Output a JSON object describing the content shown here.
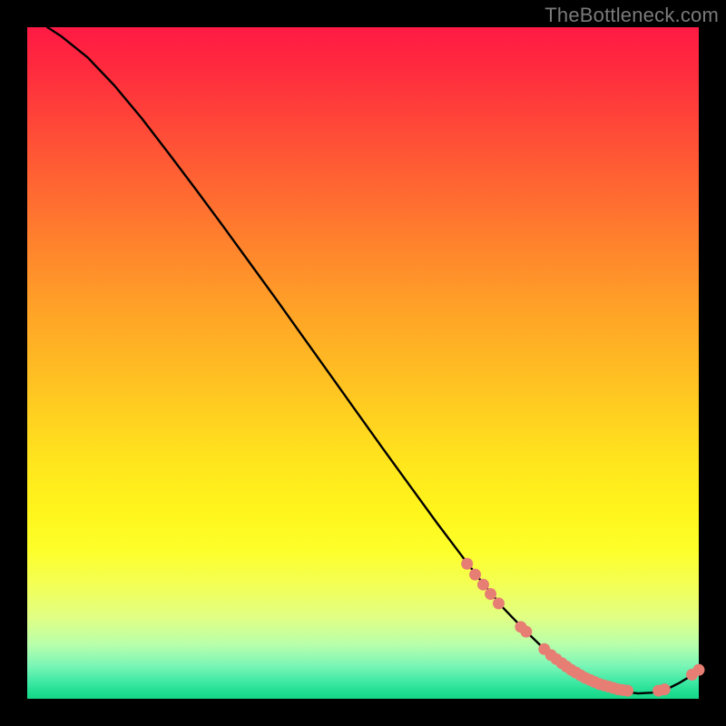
{
  "watermark": {
    "text": "TheBottleneck.com"
  },
  "colors": {
    "background": "#000000",
    "curve": "#000000",
    "point": "#e77e74",
    "gradient_top": "#ff1a44",
    "gradient_bottom": "#16d686"
  },
  "chart_data": {
    "type": "line",
    "title": "",
    "xlabel": "",
    "ylabel": "",
    "xlim": [
      0,
      100
    ],
    "ylim": [
      0,
      100
    ],
    "annotations": [],
    "series": [
      {
        "name": "curve",
        "style": "line",
        "x": [
          3,
          5,
          9,
          13,
          17,
          21,
          25,
          29,
          33,
          37,
          41,
          45,
          49,
          53,
          57,
          61,
          65,
          68,
          71,
          74,
          77,
          79,
          81,
          83,
          85,
          87,
          89,
          91,
          93,
          95,
          97,
          98.5,
          100
        ],
        "y": [
          100,
          98.7,
          95.5,
          91.3,
          86.5,
          81.3,
          76,
          70.6,
          65.1,
          59.6,
          54,
          48.4,
          42.8,
          37.2,
          31.7,
          26.2,
          20.9,
          17,
          13.4,
          10.3,
          7.4,
          5.7,
          4.2,
          3,
          2.1,
          1.4,
          1,
          0.8,
          0.9,
          1.3,
          2.3,
          3.2,
          4.3
        ]
      },
      {
        "name": "points-cluster",
        "style": "scatter",
        "x": [
          65.5,
          66.7,
          67.9,
          69,
          70.2,
          73.5,
          74.3,
          77,
          78,
          78.8,
          79.6,
          80.3,
          81,
          81.7,
          82.4,
          83.1,
          83.8,
          84.5,
          85.2,
          85.9,
          86.6,
          87.3,
          88,
          88.7,
          89.4,
          94,
          94.9,
          99,
          100
        ],
        "y": [
          20.1,
          18.5,
          17,
          15.6,
          14.2,
          10.7,
          10,
          7.4,
          6.5,
          5.9,
          5.3,
          4.8,
          4.3,
          3.9,
          3.5,
          3.1,
          2.8,
          2.5,
          2.2,
          2,
          1.8,
          1.6,
          1.4,
          1.3,
          1.2,
          1.2,
          1.4,
          3.6,
          4.3
        ]
      }
    ]
  }
}
